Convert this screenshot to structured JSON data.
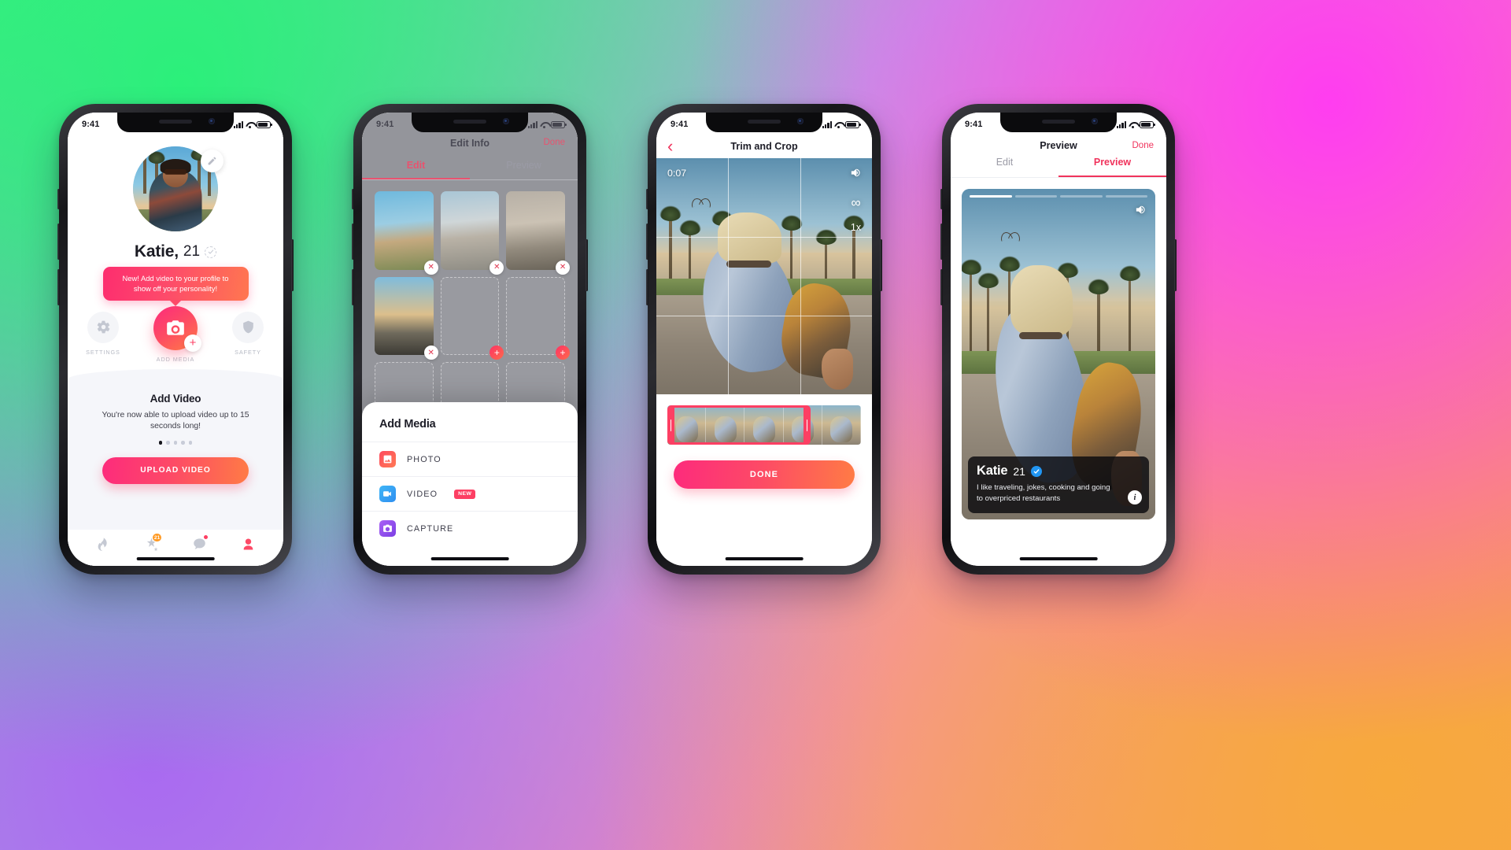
{
  "phone1": {
    "status": {
      "time": "9:41"
    },
    "profile": {
      "name": "Katie,",
      "age": "21",
      "edit_icon": "pencil-icon",
      "verified_icon": "verified-dashed-icon"
    },
    "tooltip": "New! Add video to your profile to show off your personality!",
    "actions": [
      {
        "icon": "gear-icon",
        "label": "SETTINGS"
      },
      {
        "icon": "camera-plus-icon",
        "label": "ADD MEDIA"
      },
      {
        "icon": "shield-icon",
        "label": "SAFETY"
      }
    ],
    "card": {
      "title": "Add Video",
      "body": "You're now able to upload video up to 15 seconds long!",
      "dots_total": 5,
      "dots_active": 1,
      "cta": "UPLOAD VIDEO"
    },
    "tabbar": [
      {
        "icon": "flame-icon",
        "badge": ""
      },
      {
        "icon": "star-icon",
        "badge": "21"
      },
      {
        "icon": "chat-icon",
        "badge": "dot"
      },
      {
        "icon": "person-icon",
        "badge": ""
      }
    ]
  },
  "phone2": {
    "status": {
      "time": "9:41"
    },
    "header": {
      "title": "Edit Info",
      "done": "Done"
    },
    "tabs": [
      {
        "label": "Edit",
        "active": true
      },
      {
        "label": "Preview",
        "active": false
      }
    ],
    "grid": [
      {
        "filled": true,
        "style": "ph-a"
      },
      {
        "filled": true,
        "style": "ph-b"
      },
      {
        "filled": true,
        "style": "ph-c"
      },
      {
        "filled": true,
        "style": "ph-d"
      },
      {
        "filled": false,
        "style": ""
      },
      {
        "filled": false,
        "style": ""
      },
      {
        "filled": false,
        "style": ""
      },
      {
        "filled": false,
        "style": ""
      },
      {
        "filled": false,
        "style": ""
      }
    ],
    "sheet": {
      "title": "Add Media",
      "items": [
        {
          "label": "PHOTO",
          "icon": "photo-icon",
          "badge": ""
        },
        {
          "label": "VIDEO",
          "icon": "video-icon",
          "badge": "NEW"
        },
        {
          "label": "CAPTURE",
          "icon": "capture-icon",
          "badge": ""
        }
      ]
    }
  },
  "phone3": {
    "status": {
      "time": "9:41"
    },
    "header": {
      "title": "Trim and Crop",
      "back_icon": "chevron-left-icon"
    },
    "video": {
      "timestamp": "0:07",
      "volume_icon": "speaker-icon",
      "loop_icon": "loop-infinity-icon",
      "speed": "1x",
      "grid_overlay": true
    },
    "trim": {
      "frames": 5,
      "selection_start_pct": 0,
      "selection_end_pct": 74
    },
    "cta": "DONE"
  },
  "phone4": {
    "status": {
      "time": "9:41"
    },
    "header": {
      "title": "Preview",
      "done": "Done"
    },
    "tabs": [
      {
        "label": "Edit",
        "active": false
      },
      {
        "label": "Preview",
        "active": true
      }
    ],
    "card": {
      "progress_total": 4,
      "progress_active": 1,
      "volume_icon": "speaker-icon",
      "name": "Katie",
      "age": "21",
      "verified_icon": "verified-blue-icon",
      "bio": "I like traveling, jokes, cooking and going to overpriced restaurants",
      "info_icon": "info-icon"
    }
  },
  "colors": {
    "accent_pink": "#fd3f63",
    "accent_orange": "#ff7b45",
    "accent_red": "#f0335c",
    "verified_blue": "#2196f3",
    "badge_orange": "#ff9a24"
  }
}
